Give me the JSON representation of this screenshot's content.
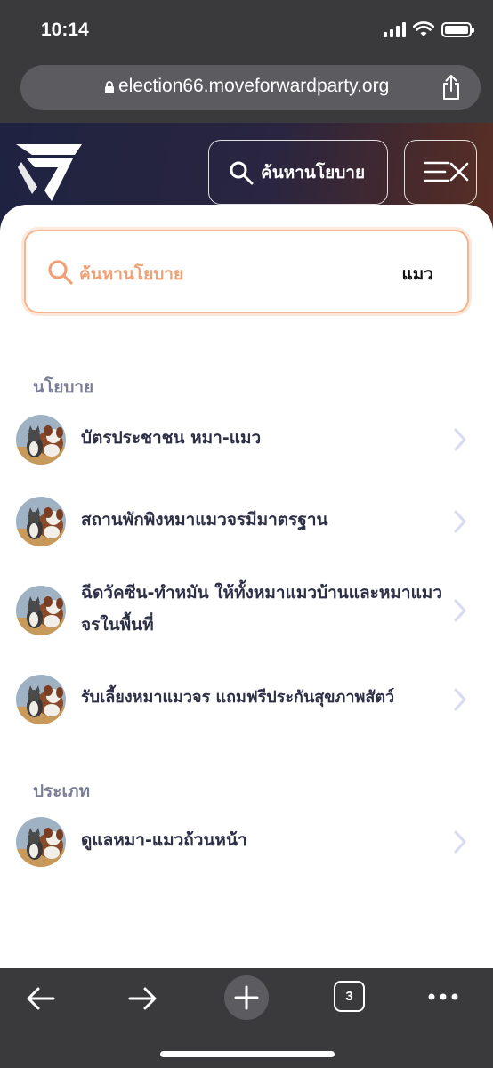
{
  "status_bar": {
    "time": "10:14"
  },
  "browser": {
    "url": "election66.moveforwardparty.org",
    "tab_count": "3"
  },
  "header": {
    "search_button_label": "ค้นหานโยบาย"
  },
  "search": {
    "placeholder": "ค้นหานโยบาย",
    "value": "แมว",
    "accent_color": "#f3b48e"
  },
  "sections": [
    {
      "label": "นโยบาย",
      "items": [
        {
          "title": "บัตรประชาชน หมา-แมว"
        },
        {
          "title": "สถานพักพิงหมาแมวจรมีมาตรฐาน"
        },
        {
          "title": "ฉีดวัคซีน-ทำหมัน ให้ทั้งหมาแมวบ้านและหมาแมวจรในพื้นที่"
        },
        {
          "title": "รับเลี้ยงหมาแมวจร แถมฟรีประกันสุขภาพสัตว์"
        }
      ]
    },
    {
      "label": "ประเภท",
      "items": [
        {
          "title": "ดูแลหมา-แมวถ้วนหน้า"
        }
      ]
    }
  ],
  "icons": {
    "lock": "lock-icon",
    "share": "share-icon",
    "search": "search-icon",
    "menu": "menu-close-icon",
    "chevron": "chevron-right-icon",
    "back": "arrow-left-icon",
    "forward": "arrow-right-icon",
    "new_tab": "plus-icon",
    "tabs": "tabs-icon",
    "more": "more-icon"
  }
}
